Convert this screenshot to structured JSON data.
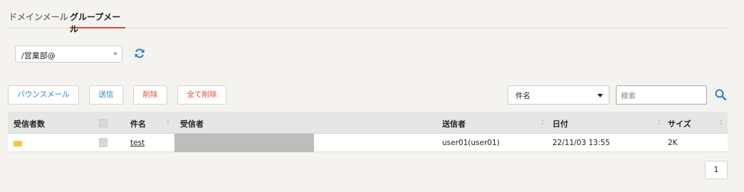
{
  "tabs": [
    {
      "label": "ドメインメール",
      "active": false
    },
    {
      "label": "グループメール",
      "active": true
    }
  ],
  "mailbox": {
    "selected": "/営業部@"
  },
  "toolbar": {
    "bounce_mail_label": "バウンスメール",
    "send_label": "送信",
    "delete_label": "削除",
    "delete_all_label": "全て削除"
  },
  "search": {
    "field_selected": "件名",
    "placeholder": "検索"
  },
  "table": {
    "headers": {
      "recipient_count": "受信者数",
      "subject": "件名",
      "recipient": "受信者",
      "sender": "送信者",
      "date": "日付",
      "size": "サイズ"
    },
    "rows": [
      {
        "subject": "test",
        "sender": "user01(user01)",
        "date": "22/11/03 13:55",
        "size": "2K"
      }
    ]
  },
  "pagination": {
    "current_page": "1"
  },
  "colors": {
    "accent_blue": "#2d7fd0",
    "accent_red": "#e04c3c",
    "mail_icon": "#f4c542"
  }
}
